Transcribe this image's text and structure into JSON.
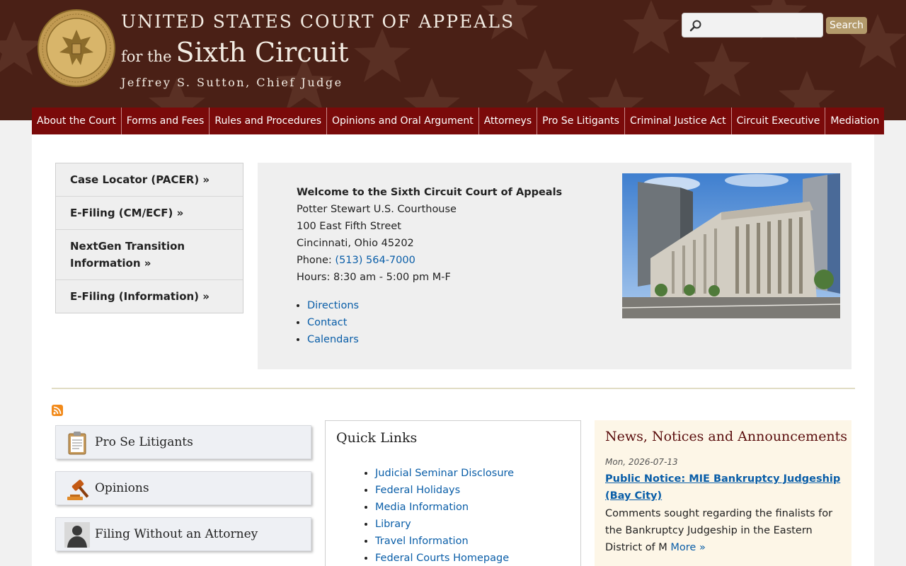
{
  "header": {
    "title_line1": "UNITED STATES COURT OF APPEALS",
    "title_line2_small": "for the",
    "title_line2_big": "Sixth Circuit",
    "chief_judge": "Jeffrey S. Sutton, Chief Judge",
    "search_placeholder": "",
    "search_button": "Search"
  },
  "nav": {
    "items": [
      "About the Court",
      "Forms and Fees",
      "Rules and Procedures",
      "Opinions and Oral Argument",
      "Attorneys",
      "Pro Se Litigants",
      "Criminal Justice Act",
      "Circuit Executive",
      "Mediation"
    ]
  },
  "quick_menu": {
    "items": [
      "Case Locator (PACER) »",
      "E-Filing (CM/ECF) »",
      "NextGen Transition Information »",
      "E-Filing (Information) »"
    ]
  },
  "welcome": {
    "title": "Welcome to the Sixth Circuit Court of Appeals",
    "building": "Potter Stewart U.S. Courthouse",
    "street": "100 East Fifth Street",
    "city": "Cincinnati, Ohio 45202",
    "phone_label": "Phone: ",
    "phone": "(513) 564-7000",
    "hours": "Hours: 8:30 am - 5:00 pm M-F",
    "links": [
      "Directions",
      "Contact",
      "Calendars"
    ]
  },
  "features": {
    "items": [
      "Pro Se Litigants",
      "Opinions",
      "Filing Without an Attorney"
    ]
  },
  "quick_links": {
    "title": "Quick Links",
    "items": [
      "Judicial Seminar Disclosure",
      "Federal Holidays",
      "Media Information",
      "Library",
      "Travel Information",
      "Federal Courts Homepage"
    ]
  },
  "news": {
    "title": "News, Notices and Announcements",
    "date": "Mon, 2026-07-13",
    "headline": "Public Notice: MIE Bankruptcy Judgeship (Bay City)",
    "body": "Comments sought regarding the finalists for the Bankruptcy Judgeship in the Eastern District of M",
    "more": "More »"
  },
  "colors": {
    "header_bg": "#4a2016",
    "nav_bg": "#7a0a0a",
    "link": "#0a5ea8",
    "search_button": "#b39a6b",
    "news_bg": "#fdf6e7"
  }
}
